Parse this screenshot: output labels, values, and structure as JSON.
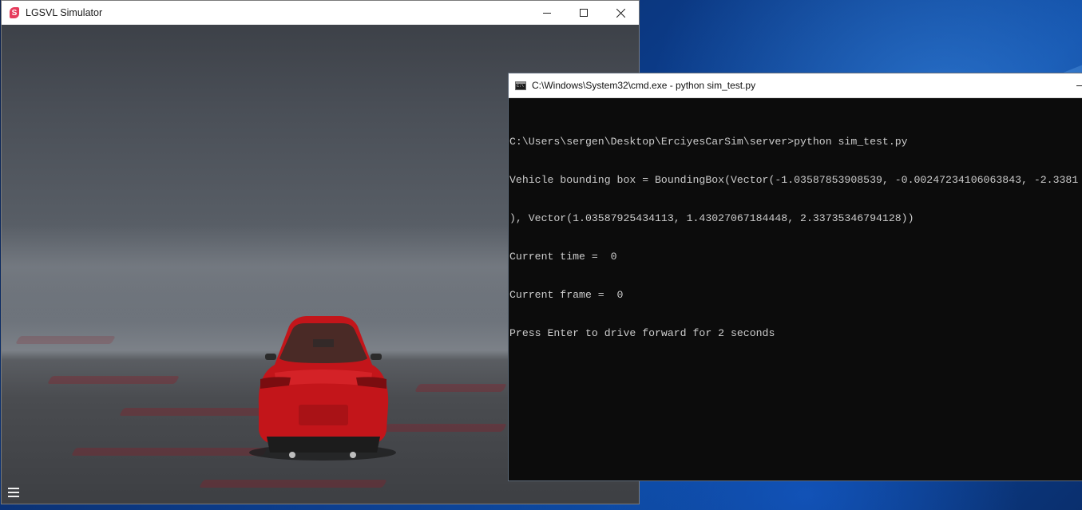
{
  "colors": {
    "desktop_blue": "#0b3a86",
    "sim_icon": "#e63c5c",
    "console_bg": "#0c0c0c",
    "console_text": "#cccccc",
    "car_red": "#c8161c"
  },
  "sim_window": {
    "title": "LGSVL Simulator",
    "icon": "lgsvl-logo-icon",
    "controls": {
      "minimize": "minimize-icon",
      "maximize": "maximize-icon",
      "close": "close-icon"
    },
    "menu_icon": "hamburger-menu-icon"
  },
  "cmd_window": {
    "title": "C:\\Windows\\System32\\cmd.exe - python  sim_test.py",
    "icon": "cmd-icon",
    "minimize": "minimize-icon",
    "lines": [
      "C:\\Users\\sergen\\Desktop\\ErciyesCarSim\\server>python sim_test.py",
      "Vehicle bounding box = BoundingBox(Vector(-1.03587853908539, -0.00247234106063843, -2.3381",
      "), Vector(1.03587925434113, 1.43027067184448, 2.33735346794128))",
      "Current time =  0",
      "Current frame =  0",
      "Press Enter to drive forward for 2 seconds"
    ]
  }
}
